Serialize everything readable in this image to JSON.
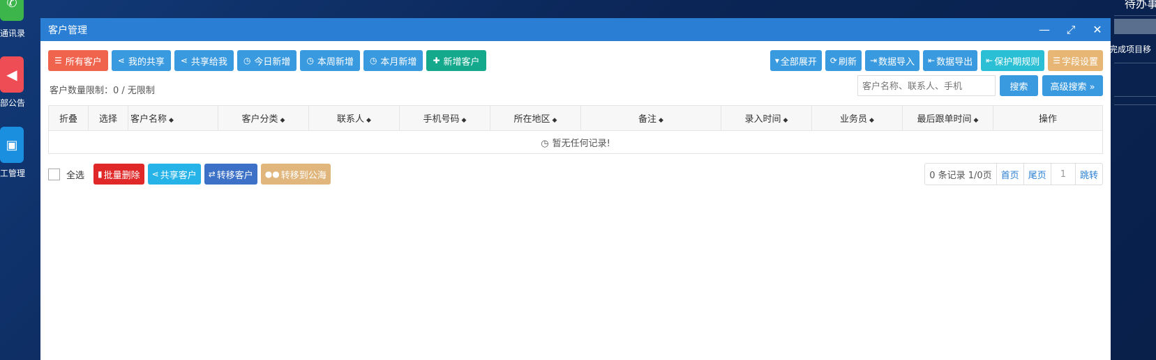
{
  "desktop": {
    "icons": [
      {
        "label": "通讯录",
        "color": "#3cb54a"
      },
      {
        "label": "部公告",
        "color": "#ee4d55"
      },
      {
        "label": "工管理",
        "color": "#1a8fe0"
      }
    ]
  },
  "side_panel": {
    "title": "待办事项",
    "text": "完成项目移"
  },
  "window": {
    "title": "客户管理",
    "controls": {
      "minimize": "—",
      "maximize": "⤢",
      "close": "✕"
    }
  },
  "toolbar_left": [
    {
      "label": "所有客户",
      "icon": "list-icon",
      "glyph": "☰",
      "color": "#f0644e"
    },
    {
      "label": "我的共享",
      "icon": "share-icon",
      "glyph": "⋖",
      "color": "#3a9ae0"
    },
    {
      "label": "共享给我",
      "icon": "share-icon",
      "glyph": "⋖",
      "color": "#3a9ae0"
    },
    {
      "label": "今日新增",
      "icon": "clock-icon",
      "glyph": "◷",
      "color": "#3a9ae0"
    },
    {
      "label": "本周新增",
      "icon": "clock-icon",
      "glyph": "◷",
      "color": "#3a9ae0"
    },
    {
      "label": "本月新增",
      "icon": "clock-icon",
      "glyph": "◷",
      "color": "#3a9ae0"
    },
    {
      "label": "新增客户",
      "icon": "plus-icon",
      "glyph": "✚",
      "color": "#14a98c"
    }
  ],
  "toolbar_right": [
    {
      "label": "全部展开",
      "icon": "caret-down-icon",
      "glyph": "▾",
      "color": "#3a9ae0"
    },
    {
      "label": "刷新",
      "icon": "refresh-icon",
      "glyph": "⟳",
      "color": "#3a9ae0"
    },
    {
      "label": "数据导入",
      "icon": "sign-in-icon",
      "glyph": "⇥",
      "color": "#3a9ae0"
    },
    {
      "label": "数据导出",
      "icon": "sign-out-icon",
      "glyph": "⇤",
      "color": "#3a9ae0"
    },
    {
      "label": "保护期规则",
      "icon": "sign-out-icon",
      "glyph": "⇤",
      "color": "#2bbfd5"
    },
    {
      "label": "字段设置",
      "icon": "list-icon",
      "glyph": "☰",
      "color": "#e7b675"
    }
  ],
  "limit_text": "客户数量限制：0 / 无限制",
  "search": {
    "placeholder": "客户名称、联系人、手机",
    "button": "搜索",
    "advanced": "高级搜索 »"
  },
  "table": {
    "columns": [
      "折叠",
      "选择",
      "客户名称",
      "客户分类",
      "联系人",
      "手机号码",
      "所在地区",
      "备注",
      "录入时间",
      "业务员",
      "最后跟单时间",
      "操作"
    ],
    "empty_text": "暂无任何记录!"
  },
  "bulk": {
    "select_all": "全选",
    "buttons": [
      {
        "label": "批量删除",
        "icon": "trash-icon",
        "glyph": "🗑",
        "color": "#e02828"
      },
      {
        "label": "共享客户",
        "icon": "share-icon",
        "glyph": "⋖",
        "color": "#26b3e8"
      },
      {
        "label": "转移客户",
        "icon": "exchange-icon",
        "glyph": "⇄",
        "color": "#3c71c7"
      },
      {
        "label": "转移到公海",
        "icon": "users-icon",
        "glyph": "👥",
        "color": "#e0b67d"
      }
    ]
  },
  "pager": {
    "summary": "0 条记录 1/0页",
    "first": "首页",
    "last": "尾页",
    "page_input": "1",
    "jump": "跳转"
  }
}
